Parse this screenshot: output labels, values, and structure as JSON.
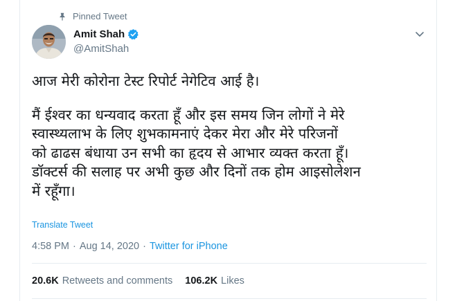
{
  "pinned_label": "Pinned Tweet",
  "author": {
    "name": "Amit Shah",
    "handle": "@AmitShah",
    "verified": true
  },
  "tweet": {
    "line1": "आज मेरी कोरोना टेस्ट रिपोर्ट नेगेटिव आई है।",
    "para2": [
      "मैं ईश्वर का धन्यवाद करता हूँ और इस समय जिन लोगों ने मेरे",
      "स्वास्थ्यलाभ के लिए शुभकामनाएं देकर मेरा और मेरे परिजनों",
      "को ढाढस बंधाया उन सभी का हृदय से आभार व्यक्त करता हूँ।",
      "डॉक्टर्स की सलाह पर अभी कुछ और दिनों तक होम आइसोलेशन",
      "में रहूँगा।"
    ]
  },
  "translate_label": "Translate Tweet",
  "meta": {
    "time": "4:58 PM",
    "sep1": "·",
    "date": "Aug 14, 2020",
    "sep2": "·",
    "source": "Twitter for iPhone"
  },
  "stats": {
    "retweets_count": "20.6K",
    "retweets_label": "Retweets and comments",
    "likes_count": "106.2K",
    "likes_label": "Likes"
  },
  "colors": {
    "link": "#1b95e0",
    "verified": "#1da1f2",
    "muted": "#657786",
    "text": "#14171a"
  },
  "icons": {
    "pin": "pin-icon",
    "verified": "verified-badge-icon",
    "caret": "chevron-down-icon"
  }
}
